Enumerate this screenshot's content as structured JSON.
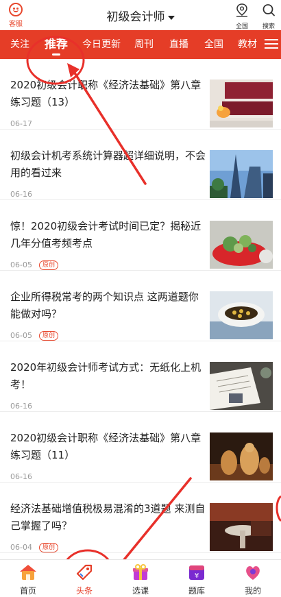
{
  "header": {
    "service_label": "客服",
    "title": "初级会计师",
    "location_label": "全国",
    "search_label": "搜索"
  },
  "tabs": [
    {
      "label": "关注",
      "active": false
    },
    {
      "label": "推荐",
      "active": true
    },
    {
      "label": "今日更新",
      "active": false
    },
    {
      "label": "周刊",
      "active": false
    },
    {
      "label": "直播",
      "active": false
    },
    {
      "label": "全国",
      "active": false
    },
    {
      "label": "教材",
      "active": false
    }
  ],
  "articles": [
    {
      "title": "2020初级会计职称《经济法基础》第八章练习题（13）",
      "date": "06-17",
      "badge": ""
    },
    {
      "title": "初级会计机考系统计算器超详细说明，不会用的看过来",
      "date": "06-16",
      "badge": ""
    },
    {
      "title": "惊！2020初级会计考试时间已定？揭秘近几年分值考频考点",
      "date": "06-05",
      "badge": "原创"
    },
    {
      "title": "企业所得税常考的两个知识点 这两道题你能做对吗？",
      "date": "06-05",
      "badge": "原创"
    },
    {
      "title": "2020年初级会计师考试方式：无纸化上机考！",
      "date": "06-16",
      "badge": ""
    },
    {
      "title": "2020初级会计职称《经济法基础》第八章练习题（11）",
      "date": "06-16",
      "badge": ""
    },
    {
      "title": "经济法基础增值税极易混淆的3道题 来测自己掌握了吗？",
      "date": "06-04",
      "badge": "原创"
    }
  ],
  "bottom_nav": [
    {
      "label": "首页",
      "icon": "home-icon",
      "active": false
    },
    {
      "label": "头条",
      "icon": "headline-tag-icon",
      "active": true
    },
    {
      "label": "选课",
      "icon": "course-gift-icon",
      "active": false
    },
    {
      "label": "题库",
      "icon": "question-bank-icon",
      "active": false
    },
    {
      "label": "我的",
      "icon": "profile-icon",
      "active": false
    }
  ],
  "colors": {
    "brand_red": "#e53d27",
    "annotation_red": "#e8302a"
  }
}
